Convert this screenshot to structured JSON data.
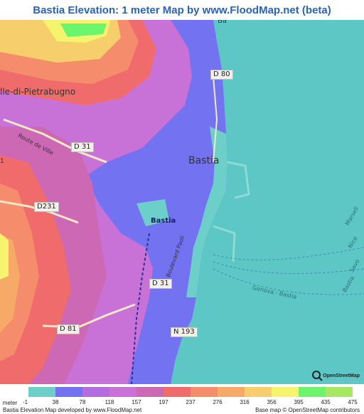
{
  "title": "Bastia Elevation: 1 meter Map by www.FloodMap.net (beta)",
  "map": {
    "place_labels": {
      "city": "Bastia",
      "district": "lle-di-Pietrabugno",
      "poi": "Bastia",
      "top_edge": "Ba",
      "left_edge": "1"
    },
    "road_labels": [
      "D 80",
      "D 31",
      "D231",
      "D 31",
      "D 81",
      "N 193"
    ],
    "street_labels": {
      "route_de_ville": "Route de Ville",
      "boulevard_paoli": "Boulevard Paoli",
      "genova_bastia": "Genova - Bastia"
    },
    "ferry_labels": [
      "Marsell",
      "Nice",
      "Savo",
      "Bastia"
    ],
    "osm_badge": "OpenStreetMap"
  },
  "legend": {
    "unit_label": "meter",
    "stops": [
      "-1",
      "38",
      "78",
      "118",
      "157",
      "197",
      "237",
      "276",
      "316",
      "356",
      "395",
      "435",
      "475"
    ],
    "colors": [
      "#6ccfc9",
      "#7373f2",
      "#b36de0",
      "#c872d8",
      "#cc68b4",
      "#f06c6c",
      "#f58c6c",
      "#f7aa68",
      "#f6cf6c",
      "#f6f46c",
      "#6cf46c",
      "#a7e862"
    ]
  },
  "footer": {
    "left": "Bastia Elevation Map developed by www.FloodMap.net",
    "right": "Base map © OpenStreetMap contributors"
  }
}
